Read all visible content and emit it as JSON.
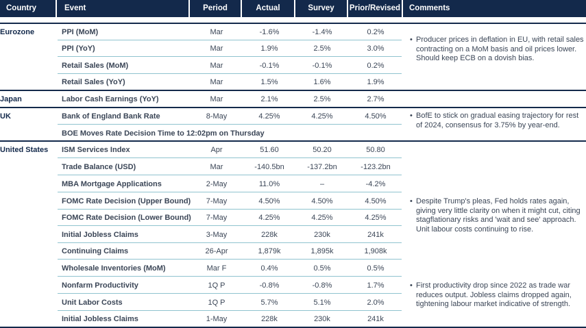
{
  "headers": {
    "country": "Country",
    "event": "Event",
    "period": "Period",
    "actual": "Actual",
    "survey": "Survey",
    "prior": "Prior/Revised",
    "comments": "Comments"
  },
  "sections": {
    "eurozone": {
      "country": "Eurozone",
      "rows": [
        {
          "event": "PPI (MoM)",
          "period": "Mar",
          "actual": "-1.6%",
          "survey": "-1.4%",
          "prior": "0.2%"
        },
        {
          "event": "PPI (YoY)",
          "period": "Mar",
          "actual": "1.9%",
          "survey": "2.5%",
          "prior": "3.0%"
        },
        {
          "event": "Retail Sales (MoM)",
          "period": "Mar",
          "actual": "-0.1%",
          "survey": "-0.1%",
          "prior": "0.2%"
        },
        {
          "event": "Retail Sales (YoY)",
          "period": "Mar",
          "actual": "1.5%",
          "survey": "1.6%",
          "prior": "1.9%"
        }
      ],
      "comment": "Producer prices in deflation in EU, with retail sales contracting on a MoM basis and oil prices lower. Should keep ECB on a dovish bias."
    },
    "japan": {
      "country": "Japan",
      "rows": [
        {
          "event": "Labor Cash Earnings (YoY)",
          "period": "Mar",
          "actual": "2.1%",
          "survey": "2.5%",
          "prior": "2.7%"
        }
      ]
    },
    "uk": {
      "country": "UK",
      "rows": [
        {
          "event": "Bank of England Bank Rate",
          "period": "8-May",
          "actual": "4.25%",
          "survey": "4.25%",
          "prior": "4.50%"
        }
      ],
      "note": "BOE Moves Rate Decision Time to 12:02pm on Thursday",
      "comment": "BofE to stick on gradual easing trajectory for rest of 2024, consensus for 3.75% by year-end."
    },
    "us": {
      "country": "United States",
      "rows": [
        {
          "event": "ISM Services Index",
          "period": "Apr",
          "actual": "51.60",
          "survey": "50.20",
          "prior": "50.80"
        },
        {
          "event": "Trade Balance (USD)",
          "period": "Mar",
          "actual": "-140.5bn",
          "survey": "-137.2bn",
          "prior": "-123.2bn"
        },
        {
          "event": "MBA Mortgage Applications",
          "period": "2-May",
          "actual": "11.0%",
          "survey": "–",
          "prior": "-4.2%"
        },
        {
          "event": "FOMC Rate Decision (Upper Bound)",
          "period": "7-May",
          "actual": "4.50%",
          "survey": "4.50%",
          "prior": "4.50%"
        },
        {
          "event": "FOMC Rate Decision (Lower Bound)",
          "period": "7-May",
          "actual": "4.25%",
          "survey": "4.25%",
          "prior": "4.25%"
        },
        {
          "event": "Initial Jobless Claims",
          "period": "3-May",
          "actual": "228k",
          "survey": "230k",
          "prior": "241k"
        },
        {
          "event": "Continuing Claims",
          "period": "26-Apr",
          "actual": "1,879k",
          "survey": "1,895k",
          "prior": "1,908k"
        },
        {
          "event": "Wholesale Inventories (MoM)",
          "period": "Mar F",
          "actual": "0.4%",
          "survey": "0.5%",
          "prior": "0.5%"
        },
        {
          "event": "Nonfarm Productivity",
          "period": "1Q P",
          "actual": "-0.8%",
          "survey": "-0.8%",
          "prior": "1.7%"
        },
        {
          "event": "Unit Labor Costs",
          "period": "1Q P",
          "actual": "5.7%",
          "survey": "5.1%",
          "prior": "2.0%"
        },
        {
          "event": "Initial Jobless Claims",
          "period": "1-May",
          "actual": "228k",
          "survey": "230k",
          "prior": "241k"
        }
      ],
      "comment_fed": "Despite Trump's pleas, Fed holds rates again, giving very little clarity on when it might cut, citing stagflationary risks and 'wait and see' approach. Unit labour costs continuing to rise.",
      "comment_productivity": "First productivity drop since 2022 as trade war reduces output. Jobless claims dropped again, tightening labour market indicative of strength."
    }
  },
  "bullet": "•",
  "colors": {
    "header_bg": "#13294b",
    "rule": "#8fc3cf",
    "text": "#3a4556"
  }
}
